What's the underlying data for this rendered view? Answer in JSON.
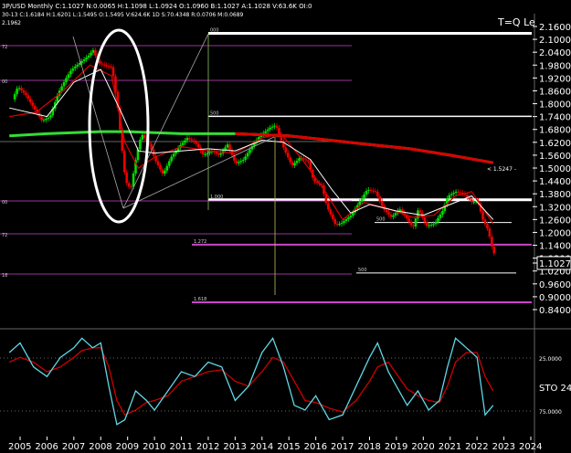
{
  "header": {
    "line1": "3P/USD Monthly  C:1.1027  N:0.0065  H:1.1098  L:1.0924  O:1.0960  B:1.1027  A:1.1028  V:63.6K  OI:0",
    "line2": "30-13  C:1.6184  H:1.6201  L:1.5495  O:1.5495  V:624.6K  1D  S:70.4348  R:0.0706  M:0.0689",
    "line3": "2.1962"
  },
  "labels": {
    "corner_note": "T=Q Le",
    "cursor_price": "1.1027",
    "ma_note": "< 1.5247 -",
    "sto_label": "STO 24"
  },
  "colors": {
    "background": "#000000",
    "up_candle": "#00dd00",
    "down_candle": "#ee0000",
    "fib_level": "#cc44cc",
    "ma_slow": "#33dd33",
    "ma_red": "#dd0000",
    "ma_white": "#ffffff",
    "stoch_k": "#5fd7e6",
    "stoch_d": "#cc0000",
    "grid_dots": "#888888",
    "highlight_ellipse": "#ffffff"
  },
  "chart_data": [
    {
      "type": "candlestick",
      "title": "",
      "instrument": "GBP/USD Monthly",
      "x_ticks": [
        "2005",
        "2006",
        "2007",
        "2008",
        "2009",
        "2010",
        "2011",
        "2012",
        "2013",
        "2014",
        "2015",
        "2016",
        "2017",
        "2018",
        "2019",
        "2020",
        "2021",
        "2022",
        "2023",
        "2024"
      ],
      "y_ticks": [
        "2.1600",
        "2.1000",
        "2.0400",
        "1.9800",
        "1.9200",
        "1.8600",
        "1.8000",
        "1.7400",
        "1.6800",
        "1.6200",
        "1.5600",
        "1.5000",
        "1.4400",
        "1.3800",
        "1.3200",
        "1.2600",
        "1.2000",
        "1.1400",
        "1.0800",
        "1.0200",
        "0.9600",
        "0.9000",
        "0.8400"
      ],
      "ylim": [
        0.82,
        2.19
      ],
      "xlim": [
        2004.6,
        2024.4
      ],
      "series": [
        {
          "name": "",
          "kind": "ohlc_approx",
          "points": [
            [
              2004.8,
              1.82
            ],
            [
              2005.0,
              1.88
            ],
            [
              2005.3,
              1.84
            ],
            [
              2005.6,
              1.78
            ],
            [
              2005.9,
              1.72
            ],
            [
              2006.2,
              1.74
            ],
            [
              2006.5,
              1.85
            ],
            [
              2006.8,
              1.92
            ],
            [
              2007.0,
              1.96
            ],
            [
              2007.3,
              1.99
            ],
            [
              2007.6,
              2.02
            ],
            [
              2007.8,
              2.05
            ],
            [
              2008.0,
              1.99
            ],
            [
              2008.2,
              1.98
            ],
            [
              2008.5,
              1.97
            ],
            [
              2008.7,
              1.8
            ],
            [
              2008.9,
              1.56
            ],
            [
              2009.0,
              1.44
            ],
            [
              2009.2,
              1.4
            ],
            [
              2009.4,
              1.55
            ],
            [
              2009.6,
              1.66
            ],
            [
              2009.9,
              1.61
            ],
            [
              2010.1,
              1.54
            ],
            [
              2010.4,
              1.47
            ],
            [
              2010.7,
              1.55
            ],
            [
              2011.0,
              1.6
            ],
            [
              2011.3,
              1.64
            ],
            [
              2011.6,
              1.62
            ],
            [
              2011.9,
              1.56
            ],
            [
              2012.2,
              1.58
            ],
            [
              2012.5,
              1.56
            ],
            [
              2012.8,
              1.61
            ],
            [
              2013.1,
              1.52
            ],
            [
              2013.4,
              1.54
            ],
            [
              2013.7,
              1.6
            ],
            [
              2014.0,
              1.65
            ],
            [
              2014.4,
              1.69
            ],
            [
              2014.6,
              1.7
            ],
            [
              2014.9,
              1.59
            ],
            [
              2015.2,
              1.51
            ],
            [
              2015.5,
              1.55
            ],
            [
              2015.8,
              1.53
            ],
            [
              2016.0,
              1.44
            ],
            [
              2016.3,
              1.42
            ],
            [
              2016.5,
              1.32
            ],
            [
              2016.8,
              1.24
            ],
            [
              2017.0,
              1.24
            ],
            [
              2017.4,
              1.28
            ],
            [
              2017.7,
              1.34
            ],
            [
              2018.0,
              1.4
            ],
            [
              2018.3,
              1.39
            ],
            [
              2018.6,
              1.31
            ],
            [
              2018.9,
              1.27
            ],
            [
              2019.2,
              1.31
            ],
            [
              2019.5,
              1.26
            ],
            [
              2019.7,
              1.22
            ],
            [
              2019.9,
              1.31
            ],
            [
              2020.2,
              1.23
            ],
            [
              2020.5,
              1.24
            ],
            [
              2020.8,
              1.3
            ],
            [
              2021.0,
              1.37
            ],
            [
              2021.3,
              1.39
            ],
            [
              2021.6,
              1.38
            ],
            [
              2021.9,
              1.34
            ],
            [
              2022.1,
              1.35
            ],
            [
              2022.3,
              1.26
            ],
            [
              2022.5,
              1.21
            ],
            [
              2022.6,
              1.15
            ],
            [
              2022.7,
              1.1027
            ]
          ]
        },
        {
          "name": "",
          "kind": "moving_average_slow",
          "points": [
            [
              2004.6,
              1.65
            ],
            [
              2006.0,
              1.66
            ],
            [
              2008.0,
              1.67
            ],
            [
              2009.0,
              1.67
            ],
            [
              2011.0,
              1.66
            ],
            [
              2013.0,
              1.66
            ],
            [
              2015.0,
              1.65
            ],
            [
              2016.5,
              1.63
            ],
            [
              2018.0,
              1.61
            ],
            [
              2019.5,
              1.59
            ],
            [
              2021.0,
              1.56
            ],
            [
              2022.6,
              1.5247
            ]
          ]
        },
        {
          "name": "",
          "kind": "moving_average_fast",
          "points": [
            [
              2004.6,
              1.78
            ],
            [
              2006.0,
              1.74
            ],
            [
              2007.0,
              1.9
            ],
            [
              2008.0,
              1.96
            ],
            [
              2008.8,
              1.75
            ],
            [
              2009.4,
              1.58
            ],
            [
              2010.0,
              1.57
            ],
            [
              2011.0,
              1.58
            ],
            [
              2012.0,
              1.59
            ],
            [
              2013.0,
              1.58
            ],
            [
              2014.0,
              1.63
            ],
            [
              2014.8,
              1.62
            ],
            [
              2015.8,
              1.54
            ],
            [
              2016.6,
              1.4
            ],
            [
              2017.3,
              1.29
            ],
            [
              2018.0,
              1.33
            ],
            [
              2019.0,
              1.3
            ],
            [
              2020.0,
              1.28
            ],
            [
              2021.0,
              1.33
            ],
            [
              2021.8,
              1.37
            ],
            [
              2022.6,
              1.26
            ]
          ]
        },
        {
          "name": "",
          "kind": "moving_average_mid",
          "points": [
            [
              2004.6,
              1.74
            ],
            [
              2005.6,
              1.76
            ],
            [
              2006.6,
              1.86
            ],
            [
              2007.6,
              1.98
            ],
            [
              2008.4,
              1.93
            ],
            [
              2008.9,
              1.62
            ],
            [
              2009.4,
              1.5
            ],
            [
              2010.0,
              1.55
            ],
            [
              2011.0,
              1.6
            ],
            [
              2012.0,
              1.58
            ],
            [
              2013.0,
              1.57
            ],
            [
              2014.0,
              1.64
            ],
            [
              2014.7,
              1.66
            ],
            [
              2015.5,
              1.54
            ],
            [
              2016.3,
              1.4
            ],
            [
              2017.0,
              1.26
            ],
            [
              2017.8,
              1.34
            ],
            [
              2018.7,
              1.31
            ],
            [
              2019.6,
              1.27
            ],
            [
              2020.4,
              1.28
            ],
            [
              2021.2,
              1.37
            ],
            [
              2021.8,
              1.39
            ],
            [
              2022.6,
              1.24
            ]
          ]
        }
      ],
      "fib_levels": [
        {
          "label": "1.000",
          "price": 1.352,
          "color": "#ffffff"
        },
        {
          "label": "500",
          "price": 1.741,
          "color": "#ffffff"
        },
        {
          "label": "000",
          "price": 2.128,
          "color": "#ffffff"
        },
        {
          "label": "1.272",
          "price": 1.143,
          "color": "#cc44cc"
        },
        {
          "label": "1.618",
          "price": 0.874,
          "color": "#cc44cc"
        },
        {
          "label": "500",
          "price": 1.246,
          "color": "#ffffff"
        },
        {
          "label": "500",
          "price": 1.011,
          "color": "#ffffff"
        }
      ],
      "left_fib_labels": [
        "72",
        "00",
        "00",
        "72",
        "18"
      ],
      "cursor_price": 1.1027,
      "ma_label": "1.5247"
    },
    {
      "type": "line",
      "title": "",
      "indicator": "Stochastic",
      "y_ticks": [
        "25.0000",
        "75.0000"
      ],
      "ylim": [
        0,
        100
      ],
      "x": [
        2004.6,
        2005.0,
        2005.5,
        2006.0,
        2006.5,
        2007.0,
        2007.3,
        2007.7,
        2008.0,
        2008.3,
        2008.6,
        2008.9,
        2009.3,
        2009.7,
        2010.0,
        2010.5,
        2011.0,
        2011.5,
        2012.0,
        2012.5,
        2013.0,
        2013.5,
        2014.0,
        2014.4,
        2014.8,
        2015.2,
        2015.6,
        2016.0,
        2016.5,
        2017.0,
        2017.5,
        2018.0,
        2018.3,
        2018.7,
        2019.0,
        2019.4,
        2019.8,
        2020.2,
        2020.6,
        2020.9,
        2021.2,
        2021.6,
        2022.0,
        2022.3,
        2022.6
      ],
      "series": [
        {
          "name": "",
          "values": [
            20,
            10,
            35,
            45,
            25,
            15,
            5,
            15,
            10,
            55,
            95,
            90,
            60,
            70,
            80,
            60,
            40,
            45,
            30,
            35,
            70,
            55,
            20,
            5,
            35,
            75,
            80,
            65,
            90,
            85,
            55,
            25,
            10,
            40,
            55,
            75,
            60,
            80,
            70,
            35,
            5,
            15,
            25,
            85,
            75
          ]
        },
        {
          "name": "",
          "values": [
            30,
            25,
            30,
            40,
            35,
            25,
            18,
            15,
            15,
            35,
            70,
            85,
            80,
            72,
            70,
            65,
            50,
            45,
            40,
            38,
            50,
            55,
            40,
            25,
            30,
            50,
            70,
            72,
            78,
            82,
            70,
            50,
            35,
            30,
            42,
            58,
            65,
            70,
            72,
            55,
            30,
            20,
            20,
            45,
            60
          ]
        }
      ]
    }
  ]
}
